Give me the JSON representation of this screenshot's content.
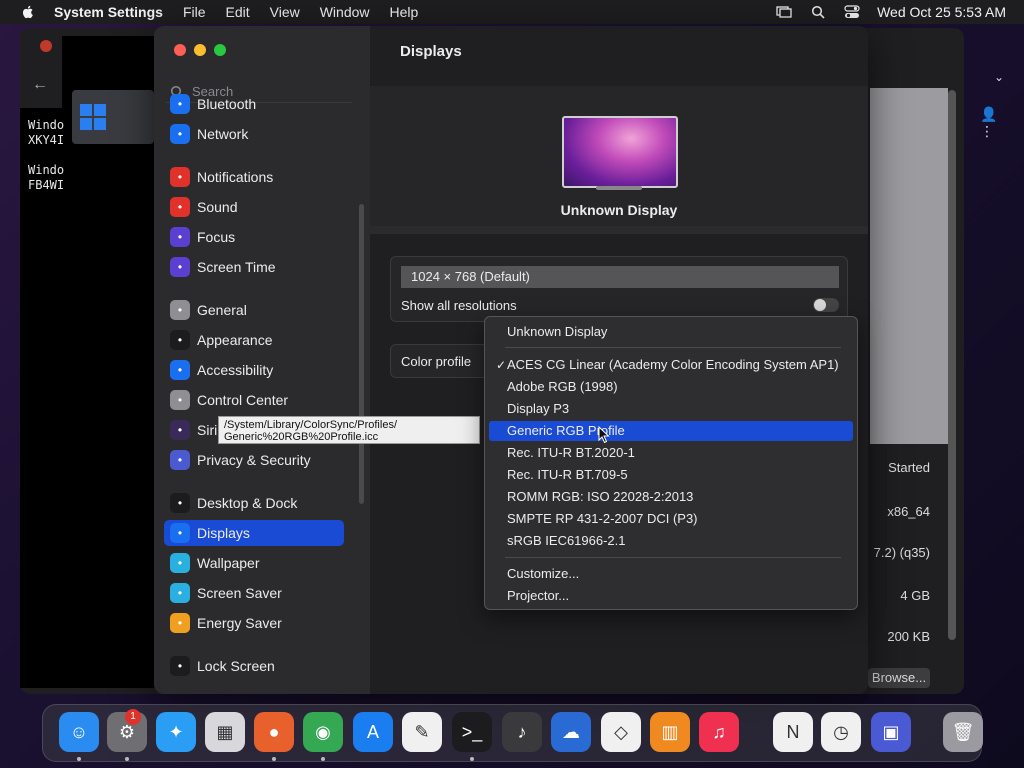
{
  "menubar": {
    "app_name": "System Settings",
    "items": [
      "File",
      "Edit",
      "View",
      "Window",
      "Help"
    ],
    "clock": "Wed Oct 25  5:53 AM"
  },
  "vm": {
    "text_lines": [
      "Windo",
      "XKY4I",
      "",
      "Windo",
      "FB4WI"
    ],
    "info": [
      "Started",
      "x86_64",
      "7.2) (q35)",
      "4 GB",
      "200 KB"
    ],
    "browse_label": "Browse..."
  },
  "sidebar": {
    "search_placeholder": "Search",
    "items": [
      {
        "label": "Bluetooth",
        "icon": "bluetooth-icon",
        "color": "#1a6ef0"
      },
      {
        "label": "Network",
        "icon": "network-icon",
        "color": "#1a6ef0"
      },
      {
        "label": "Notifications",
        "icon": "notifications-icon",
        "color": "#e0322b"
      },
      {
        "label": "Sound",
        "icon": "sound-icon",
        "color": "#e0322b"
      },
      {
        "label": "Focus",
        "icon": "focus-icon",
        "color": "#5b3fd1"
      },
      {
        "label": "Screen Time",
        "icon": "screen-time-icon",
        "color": "#5b3fd1"
      },
      {
        "label": "General",
        "icon": "general-icon",
        "color": "#8e8e93"
      },
      {
        "label": "Appearance",
        "icon": "appearance-icon",
        "color": "#1c1c1e"
      },
      {
        "label": "Accessibility",
        "icon": "accessibility-icon",
        "color": "#1a6ef0"
      },
      {
        "label": "Control Center",
        "icon": "control-center-icon",
        "color": "#8e8e93"
      },
      {
        "label": "Siri & Spotlight",
        "icon": "siri-icon",
        "color": "#3a2a5a"
      },
      {
        "label": "Privacy & Security",
        "icon": "privacy-icon",
        "color": "#4a5bd1"
      },
      {
        "label": "Desktop & Dock",
        "icon": "desktop-dock-icon",
        "color": "#1c1c1e"
      },
      {
        "label": "Displays",
        "icon": "displays-icon",
        "color": "#1a6ef0"
      },
      {
        "label": "Wallpaper",
        "icon": "wallpaper-icon",
        "color": "#2ab0e0"
      },
      {
        "label": "Screen Saver",
        "icon": "screen-saver-icon",
        "color": "#2ab0e0"
      },
      {
        "label": "Energy Saver",
        "icon": "energy-saver-icon",
        "color": "#f0a020"
      },
      {
        "label": "Lock Screen",
        "icon": "lock-screen-icon",
        "color": "#1c1c1e"
      }
    ],
    "active_index": 13
  },
  "main": {
    "title": "Displays",
    "display_name": "Unknown Display",
    "resolution": "1024 × 768 (Default)",
    "show_all_label": "Show all resolutions",
    "show_all_enabled": false,
    "color_profile_label": "Color profile"
  },
  "dropdown": {
    "items": [
      {
        "label": "Unknown Display",
        "checked": false,
        "selected": false
      },
      {
        "label": "ACES CG Linear (Academy Color Encoding System AP1)",
        "checked": true,
        "selected": false
      },
      {
        "label": "Adobe RGB (1998)",
        "checked": false,
        "selected": false
      },
      {
        "label": "Display P3",
        "checked": false,
        "selected": false
      },
      {
        "label": "Generic RGB Profile",
        "checked": false,
        "selected": true
      },
      {
        "label": "Rec. ITU-R BT.2020-1",
        "checked": false,
        "selected": false
      },
      {
        "label": "Rec. ITU-R BT.709-5",
        "checked": false,
        "selected": false
      },
      {
        "label": "ROMM RGB: ISO 22028-2:2013",
        "checked": false,
        "selected": false
      },
      {
        "label": "SMPTE RP 431-2-2007 DCI (P3)",
        "checked": false,
        "selected": false
      },
      {
        "label": "sRGB IEC61966-2.1",
        "checked": false,
        "selected": false
      },
      {
        "label": "Customize...",
        "checked": false,
        "selected": false
      },
      {
        "label": "Projector...",
        "checked": false,
        "selected": false
      }
    ],
    "check_glyph": "✓"
  },
  "tooltip": {
    "line1": "/System/Library/ColorSync/Profiles/",
    "line2": "Generic%20RGB%20Profile.icc"
  },
  "dock": {
    "badge_count": "1",
    "apps": [
      {
        "name": "finder-icon",
        "color": "#2a8cf0",
        "glyph": "☺"
      },
      {
        "name": "system-settings-icon",
        "color": "#6e6e73",
        "glyph": "⚙"
      },
      {
        "name": "safari-icon",
        "color": "#2a9df4",
        "glyph": "✦"
      },
      {
        "name": "launchpad-icon",
        "color": "#d8d8dc",
        "glyph": "▦"
      },
      {
        "name": "firefox-icon",
        "color": "#e8602c",
        "glyph": "●"
      },
      {
        "name": "chrome-icon",
        "color": "#34a853",
        "glyph": "◉"
      },
      {
        "name": "app-store-icon",
        "color": "#1a7ef0",
        "glyph": "A"
      },
      {
        "name": "textedit-icon",
        "color": "#f0f0f0",
        "glyph": "✎"
      },
      {
        "name": "terminal-icon",
        "color": "#1c1c1e",
        "glyph": ">_"
      },
      {
        "name": "garageband-icon",
        "color": "#3a3a3d",
        "glyph": "♪"
      },
      {
        "name": "weather-icon",
        "color": "#2a6ad4",
        "glyph": "☁"
      },
      {
        "name": "vscode-icon",
        "color": "#f0f0f0",
        "glyph": "◇"
      },
      {
        "name": "books-icon",
        "color": "#f08a20",
        "glyph": "▥"
      },
      {
        "name": "music-icon",
        "color": "#f03050",
        "glyph": "♫"
      },
      {
        "name": "news-icon",
        "color": "#f0f0f0",
        "glyph": "N"
      },
      {
        "name": "clock-icon",
        "color": "#f0f0f0",
        "glyph": "◷"
      },
      {
        "name": "screen-sharing-icon",
        "color": "#4a5ad4",
        "glyph": "▣"
      },
      {
        "name": "trash-icon",
        "color": "#9a9aa0",
        "glyph": "🗑"
      }
    ]
  }
}
